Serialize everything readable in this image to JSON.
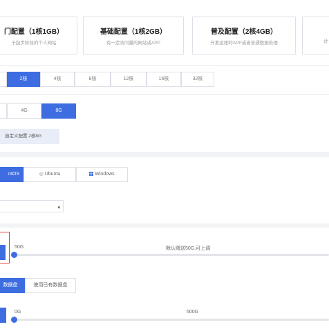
{
  "config_cards": [
    {
      "title": "门配置（1核1GB）",
      "subtitle": "于起步阶段的个人网站"
    },
    {
      "title": "基础配置（1核2GB）",
      "subtitle": "有一定访问量的网站或APP"
    },
    {
      "title": "普及配置（2核4GB）",
      "subtitle": "开发运维的APP或者普通数据处理"
    },
    {
      "title": "",
      "subtitle": "计"
    }
  ],
  "cpu": {
    "options": [
      "",
      "2核",
      "4核",
      "8核",
      "12核",
      "16核",
      "32核"
    ],
    "selected": "2核"
  },
  "memory": {
    "options": [
      "",
      "4G",
      "8G"
    ],
    "selected": "8G"
  },
  "current_config": "自定义配置 2核8G",
  "os": {
    "options": [
      "CentOS",
      "Ubuntu",
      "Windows"
    ],
    "visible_labels": [
      "ntOS",
      "Ubuntu",
      "Windows"
    ],
    "selected": "CentOS"
  },
  "version_select": {
    "value": ""
  },
  "system_disk": {
    "min_label": "50G",
    "hint": "默认赠送50G,可上调",
    "level": 0
  },
  "data_disk_tabs": {
    "options": [
      "数据盘",
      "使用已有数据盘"
    ],
    "selected": "数据盘"
  },
  "data_disk": {
    "min_label": "0G",
    "max_label": "500G",
    "level": 0
  },
  "colors": {
    "accent": "#3d6de0",
    "highlight_border": "#e0393e",
    "page_bg": "#f2f3f5"
  },
  "icons": {
    "caret": "caret-down-icon",
    "ubuntu": "ubuntu-icon",
    "windows": "windows-icon"
  }
}
